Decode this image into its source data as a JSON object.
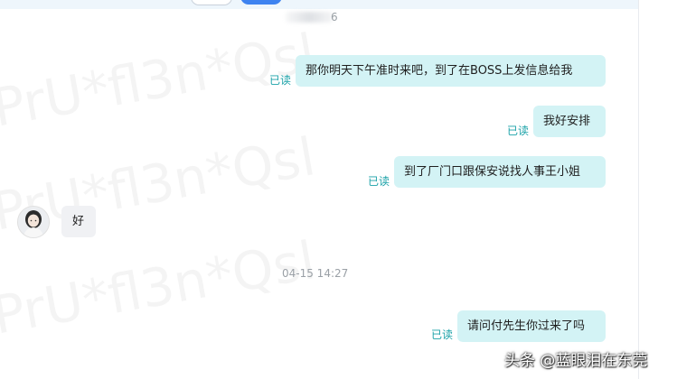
{
  "timestamps": {
    "partial_top": "6",
    "middle": "04-15 14:27"
  },
  "read_label": "已读",
  "messages": {
    "m1": "那你明天下午准时来吧，到了在BOSS上发信息给我",
    "m2": "我好安排",
    "m3": "到了厂门口跟保安说找人事王小姐",
    "m4": "好",
    "m5": "请问付先生你过来了吗"
  },
  "watermark_text": "PrU*fl3n*Qsl",
  "caption": "头条 @蓝眼泪在东莞",
  "colors": {
    "sent_bubble": "#d3f3f5",
    "received_bubble": "#f0f1f4",
    "read_status": "#1ba2a8",
    "primary_button": "#3e83f0"
  }
}
